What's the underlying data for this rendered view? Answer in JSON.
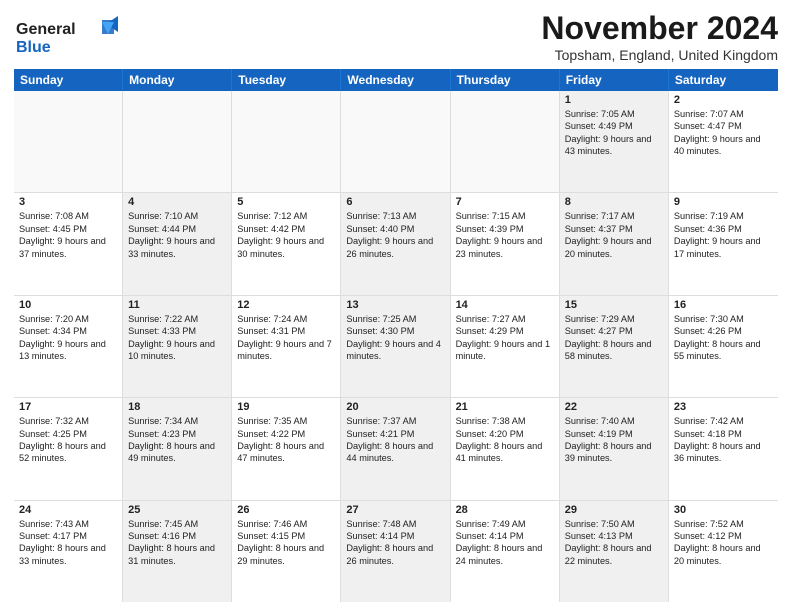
{
  "logo": {
    "line1": "General",
    "line2": "Blue"
  },
  "title": "November 2024",
  "location": "Topsham, England, United Kingdom",
  "days": [
    "Sunday",
    "Monday",
    "Tuesday",
    "Wednesday",
    "Thursday",
    "Friday",
    "Saturday"
  ],
  "rows": [
    [
      {
        "day": "",
        "sunrise": "",
        "sunset": "",
        "daylight": "",
        "shaded": false,
        "empty": true
      },
      {
        "day": "",
        "sunrise": "",
        "sunset": "",
        "daylight": "",
        "shaded": false,
        "empty": true
      },
      {
        "day": "",
        "sunrise": "",
        "sunset": "",
        "daylight": "",
        "shaded": false,
        "empty": true
      },
      {
        "day": "",
        "sunrise": "",
        "sunset": "",
        "daylight": "",
        "shaded": false,
        "empty": true
      },
      {
        "day": "",
        "sunrise": "",
        "sunset": "",
        "daylight": "",
        "shaded": false,
        "empty": true
      },
      {
        "day": "1",
        "sunrise": "Sunrise: 7:05 AM",
        "sunset": "Sunset: 4:49 PM",
        "daylight": "Daylight: 9 hours and 43 minutes.",
        "shaded": true,
        "empty": false
      },
      {
        "day": "2",
        "sunrise": "Sunrise: 7:07 AM",
        "sunset": "Sunset: 4:47 PM",
        "daylight": "Daylight: 9 hours and 40 minutes.",
        "shaded": false,
        "empty": false
      }
    ],
    [
      {
        "day": "3",
        "sunrise": "Sunrise: 7:08 AM",
        "sunset": "Sunset: 4:45 PM",
        "daylight": "Daylight: 9 hours and 37 minutes.",
        "shaded": false,
        "empty": false
      },
      {
        "day": "4",
        "sunrise": "Sunrise: 7:10 AM",
        "sunset": "Sunset: 4:44 PM",
        "daylight": "Daylight: 9 hours and 33 minutes.",
        "shaded": true,
        "empty": false
      },
      {
        "day": "5",
        "sunrise": "Sunrise: 7:12 AM",
        "sunset": "Sunset: 4:42 PM",
        "daylight": "Daylight: 9 hours and 30 minutes.",
        "shaded": false,
        "empty": false
      },
      {
        "day": "6",
        "sunrise": "Sunrise: 7:13 AM",
        "sunset": "Sunset: 4:40 PM",
        "daylight": "Daylight: 9 hours and 26 minutes.",
        "shaded": true,
        "empty": false
      },
      {
        "day": "7",
        "sunrise": "Sunrise: 7:15 AM",
        "sunset": "Sunset: 4:39 PM",
        "daylight": "Daylight: 9 hours and 23 minutes.",
        "shaded": false,
        "empty": false
      },
      {
        "day": "8",
        "sunrise": "Sunrise: 7:17 AM",
        "sunset": "Sunset: 4:37 PM",
        "daylight": "Daylight: 9 hours and 20 minutes.",
        "shaded": true,
        "empty": false
      },
      {
        "day": "9",
        "sunrise": "Sunrise: 7:19 AM",
        "sunset": "Sunset: 4:36 PM",
        "daylight": "Daylight: 9 hours and 17 minutes.",
        "shaded": false,
        "empty": false
      }
    ],
    [
      {
        "day": "10",
        "sunrise": "Sunrise: 7:20 AM",
        "sunset": "Sunset: 4:34 PM",
        "daylight": "Daylight: 9 hours and 13 minutes.",
        "shaded": false,
        "empty": false
      },
      {
        "day": "11",
        "sunrise": "Sunrise: 7:22 AM",
        "sunset": "Sunset: 4:33 PM",
        "daylight": "Daylight: 9 hours and 10 minutes.",
        "shaded": true,
        "empty": false
      },
      {
        "day": "12",
        "sunrise": "Sunrise: 7:24 AM",
        "sunset": "Sunset: 4:31 PM",
        "daylight": "Daylight: 9 hours and 7 minutes.",
        "shaded": false,
        "empty": false
      },
      {
        "day": "13",
        "sunrise": "Sunrise: 7:25 AM",
        "sunset": "Sunset: 4:30 PM",
        "daylight": "Daylight: 9 hours and 4 minutes.",
        "shaded": true,
        "empty": false
      },
      {
        "day": "14",
        "sunrise": "Sunrise: 7:27 AM",
        "sunset": "Sunset: 4:29 PM",
        "daylight": "Daylight: 9 hours and 1 minute.",
        "shaded": false,
        "empty": false
      },
      {
        "day": "15",
        "sunrise": "Sunrise: 7:29 AM",
        "sunset": "Sunset: 4:27 PM",
        "daylight": "Daylight: 8 hours and 58 minutes.",
        "shaded": true,
        "empty": false
      },
      {
        "day": "16",
        "sunrise": "Sunrise: 7:30 AM",
        "sunset": "Sunset: 4:26 PM",
        "daylight": "Daylight: 8 hours and 55 minutes.",
        "shaded": false,
        "empty": false
      }
    ],
    [
      {
        "day": "17",
        "sunrise": "Sunrise: 7:32 AM",
        "sunset": "Sunset: 4:25 PM",
        "daylight": "Daylight: 8 hours and 52 minutes.",
        "shaded": false,
        "empty": false
      },
      {
        "day": "18",
        "sunrise": "Sunrise: 7:34 AM",
        "sunset": "Sunset: 4:23 PM",
        "daylight": "Daylight: 8 hours and 49 minutes.",
        "shaded": true,
        "empty": false
      },
      {
        "day": "19",
        "sunrise": "Sunrise: 7:35 AM",
        "sunset": "Sunset: 4:22 PM",
        "daylight": "Daylight: 8 hours and 47 minutes.",
        "shaded": false,
        "empty": false
      },
      {
        "day": "20",
        "sunrise": "Sunrise: 7:37 AM",
        "sunset": "Sunset: 4:21 PM",
        "daylight": "Daylight: 8 hours and 44 minutes.",
        "shaded": true,
        "empty": false
      },
      {
        "day": "21",
        "sunrise": "Sunrise: 7:38 AM",
        "sunset": "Sunset: 4:20 PM",
        "daylight": "Daylight: 8 hours and 41 minutes.",
        "shaded": false,
        "empty": false
      },
      {
        "day": "22",
        "sunrise": "Sunrise: 7:40 AM",
        "sunset": "Sunset: 4:19 PM",
        "daylight": "Daylight: 8 hours and 39 minutes.",
        "shaded": true,
        "empty": false
      },
      {
        "day": "23",
        "sunrise": "Sunrise: 7:42 AM",
        "sunset": "Sunset: 4:18 PM",
        "daylight": "Daylight: 8 hours and 36 minutes.",
        "shaded": false,
        "empty": false
      }
    ],
    [
      {
        "day": "24",
        "sunrise": "Sunrise: 7:43 AM",
        "sunset": "Sunset: 4:17 PM",
        "daylight": "Daylight: 8 hours and 33 minutes.",
        "shaded": false,
        "empty": false
      },
      {
        "day": "25",
        "sunrise": "Sunrise: 7:45 AM",
        "sunset": "Sunset: 4:16 PM",
        "daylight": "Daylight: 8 hours and 31 minutes.",
        "shaded": true,
        "empty": false
      },
      {
        "day": "26",
        "sunrise": "Sunrise: 7:46 AM",
        "sunset": "Sunset: 4:15 PM",
        "daylight": "Daylight: 8 hours and 29 minutes.",
        "shaded": false,
        "empty": false
      },
      {
        "day": "27",
        "sunrise": "Sunrise: 7:48 AM",
        "sunset": "Sunset: 4:14 PM",
        "daylight": "Daylight: 8 hours and 26 minutes.",
        "shaded": true,
        "empty": false
      },
      {
        "day": "28",
        "sunrise": "Sunrise: 7:49 AM",
        "sunset": "Sunset: 4:14 PM",
        "daylight": "Daylight: 8 hours and 24 minutes.",
        "shaded": false,
        "empty": false
      },
      {
        "day": "29",
        "sunrise": "Sunrise: 7:50 AM",
        "sunset": "Sunset: 4:13 PM",
        "daylight": "Daylight: 8 hours and 22 minutes.",
        "shaded": true,
        "empty": false
      },
      {
        "day": "30",
        "sunrise": "Sunrise: 7:52 AM",
        "sunset": "Sunset: 4:12 PM",
        "daylight": "Daylight: 8 hours and 20 minutes.",
        "shaded": false,
        "empty": false
      }
    ]
  ]
}
